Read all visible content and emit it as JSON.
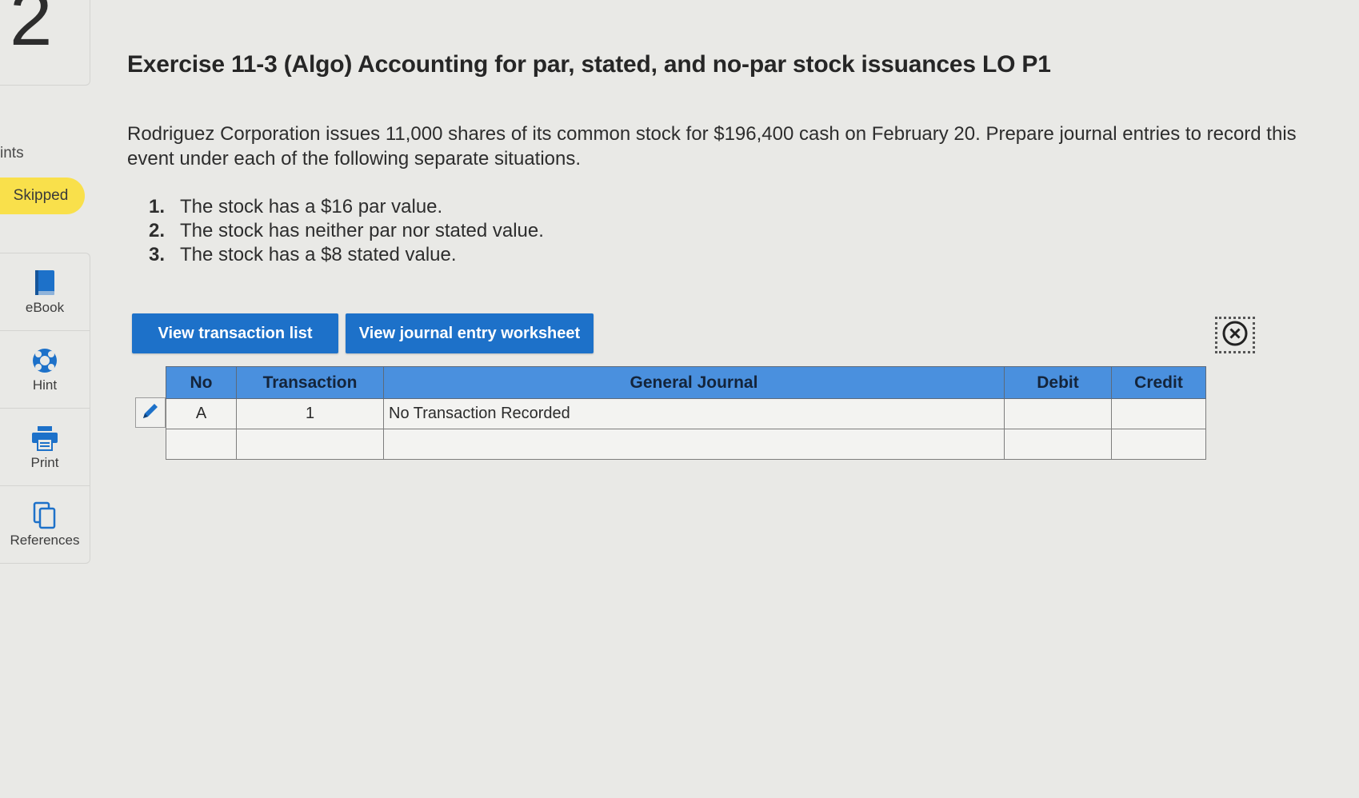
{
  "question": {
    "number": "2",
    "points_label": "ints",
    "status_badge": "Skipped"
  },
  "tools": [
    {
      "label": "eBook"
    },
    {
      "label": "Hint"
    },
    {
      "label": "Print"
    },
    {
      "label": "References"
    }
  ],
  "exercise": {
    "title": "Exercise 11-3 (Algo) Accounting for par, stated, and no-par stock issuances LO P1",
    "intro": "Rodriguez Corporation issues 11,000 shares of its common stock for $196,400 cash on February 20. Prepare journal entries to record this event under each of the following separate situations.",
    "situations": [
      {
        "num": "1.",
        "text": "The stock has a $16 par value."
      },
      {
        "num": "2.",
        "text": "The stock has neither par nor stated value."
      },
      {
        "num": "3.",
        "text": "The stock has a $8 stated value."
      }
    ]
  },
  "buttons": {
    "view_transactions": "View transaction list",
    "view_worksheet": "View journal entry worksheet"
  },
  "journal": {
    "headers": {
      "no": "No",
      "transaction": "Transaction",
      "general_journal": "General Journal",
      "debit": "Debit",
      "credit": "Credit"
    },
    "rows": [
      {
        "no": "A",
        "transaction": "1",
        "general_journal": "No Transaction Recorded",
        "debit": "",
        "credit": ""
      },
      {
        "no": "",
        "transaction": "",
        "general_journal": "",
        "debit": "",
        "credit": ""
      }
    ]
  },
  "colors": {
    "button_blue": "#1d71c9",
    "header_blue": "#4a90de",
    "badge_yellow": "#f9e04b"
  },
  "icons": {
    "ebook": "book-icon",
    "hint": "lifebuoy-icon",
    "print": "printer-icon",
    "references": "copy-icon",
    "edit": "pencil-icon",
    "close": "close-circle-icon"
  }
}
